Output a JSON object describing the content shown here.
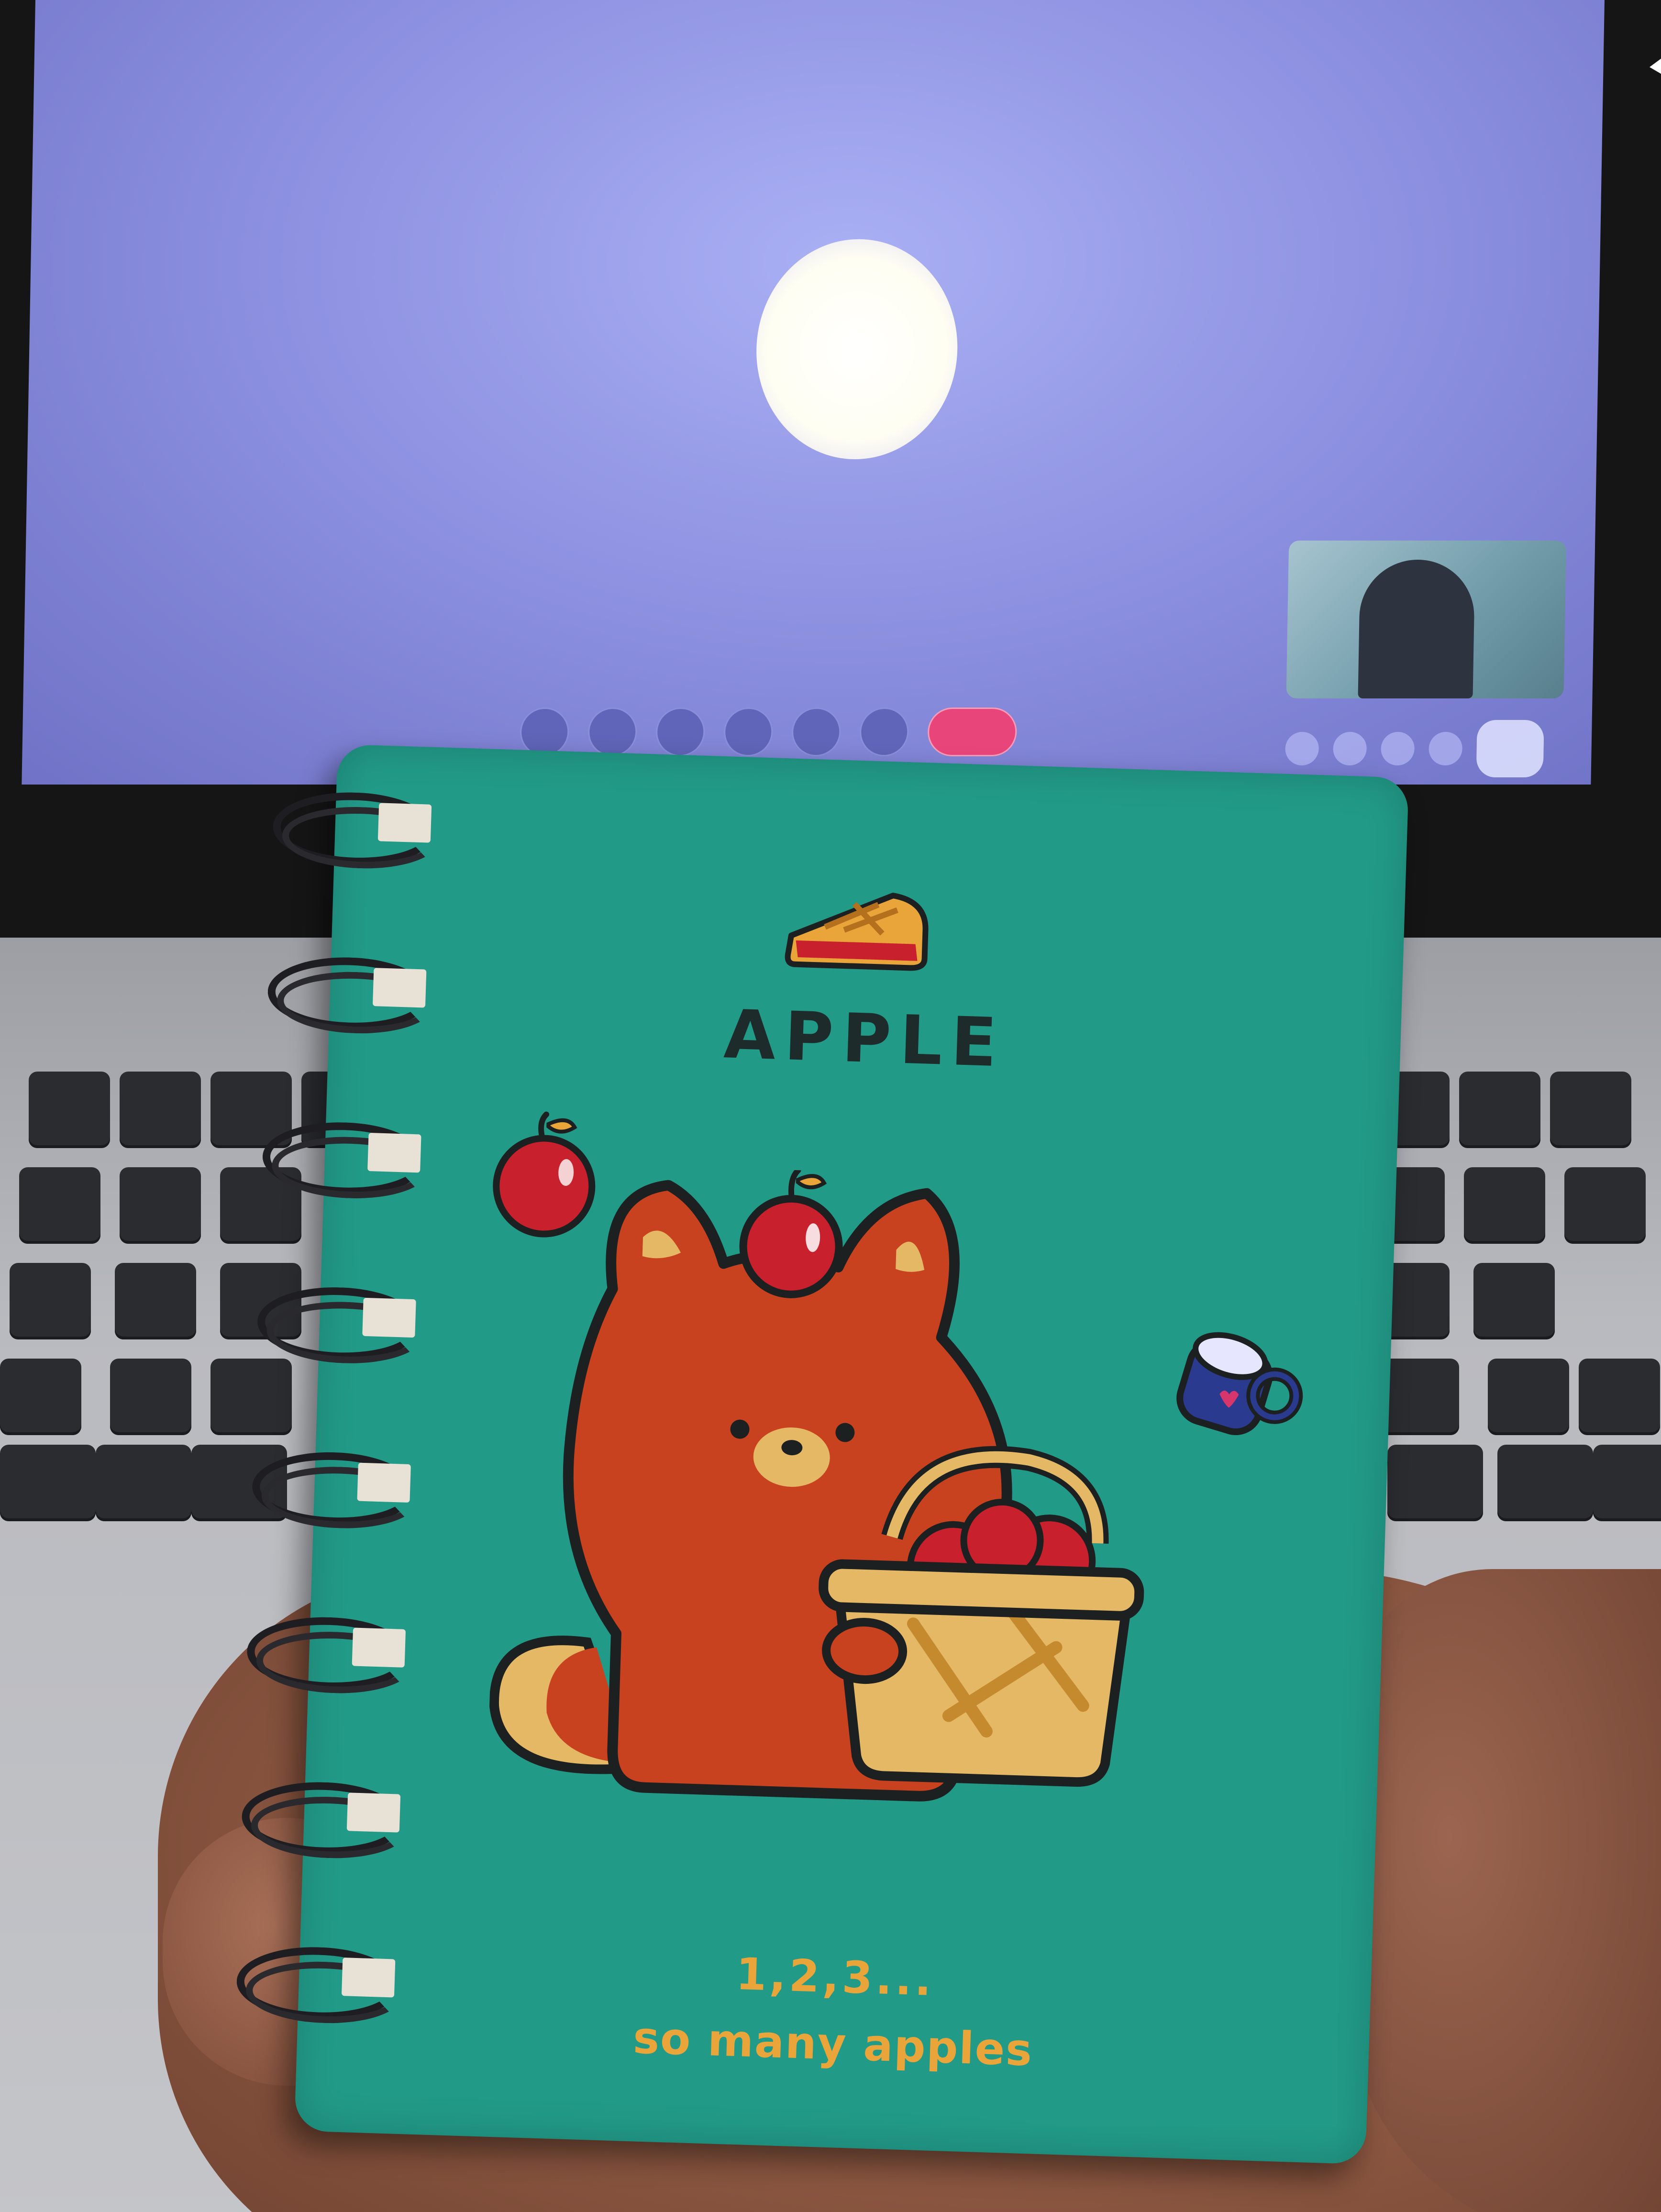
{
  "notebook": {
    "title": "APPLE",
    "tagline_line1": "1,2,3...",
    "tagline_line2": "so many apples"
  },
  "colors": {
    "cover": "#229a88",
    "title_text": "#1d2b2b",
    "tagline_text": "#e9a53a",
    "cat_body": "#c9421f",
    "apple_red": "#c8202c",
    "basket": "#e4b865",
    "mug_blue": "#2a3a8f",
    "screen_bg": "#8f93e2"
  },
  "icons": [
    "apple-pie-icon",
    "apple-icon",
    "cat-illustration",
    "mug-icon",
    "basket-icon"
  ]
}
